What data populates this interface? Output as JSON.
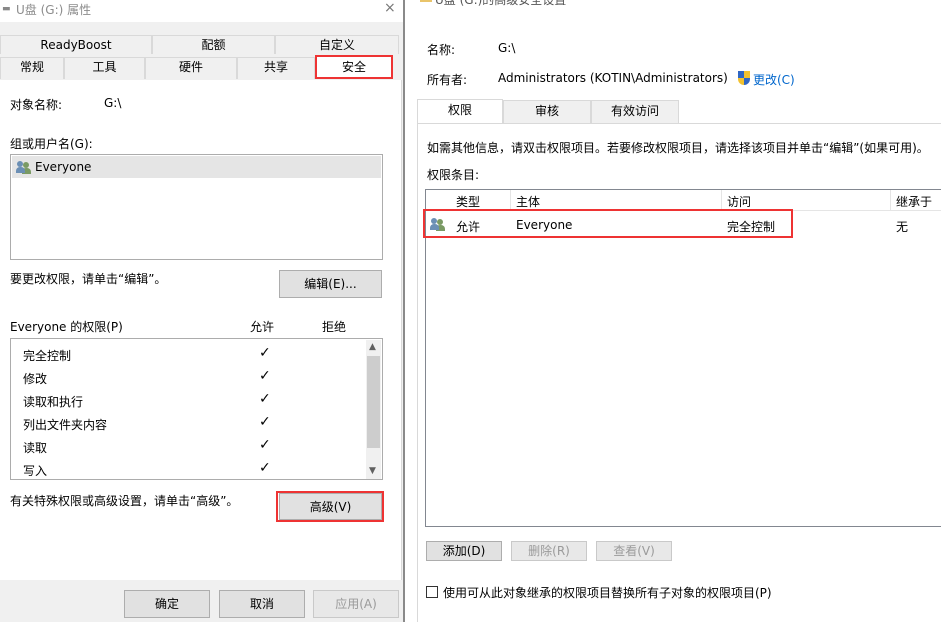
{
  "left": {
    "title": "U盘 (G:) 属性",
    "close_glyph": "×",
    "tabs_top": [
      "ReadyBoost",
      "配额",
      "自定义"
    ],
    "tabs_bottom": [
      "常规",
      "工具",
      "硬件",
      "共享",
      "安全"
    ],
    "object_name_label": "对象名称:",
    "object_name_value": "G:\\",
    "group_label": "组或用户名(G):",
    "groups": [
      {
        "name": "Everyone",
        "icon": "users-icon"
      }
    ],
    "edit_hint": "要更改权限，请单击“编辑”。",
    "edit_button": "编辑(E)...",
    "perm_header": "Everyone 的权限(P)",
    "allow_header": "允许",
    "deny_header": "拒绝",
    "permissions": [
      {
        "name": "完全控制",
        "allow": true
      },
      {
        "name": "修改",
        "allow": true
      },
      {
        "name": "读取和执行",
        "allow": true
      },
      {
        "name": "列出文件夹内容",
        "allow": true
      },
      {
        "name": "读取",
        "allow": true
      },
      {
        "name": "写入",
        "allow": true
      }
    ],
    "check_glyph": "✓",
    "advanced_hint": "有关特殊权限或高级设置，请单击“高级”。",
    "advanced_button": "高级(V)",
    "ok_button": "确定",
    "cancel_button": "取消",
    "apply_button": "应用(A)"
  },
  "right": {
    "title": "U盘 (G:)的高级安全设置",
    "name_label": "名称:",
    "name_value": "G:\\",
    "owner_label": "所有者:",
    "owner_value": "Administrators (KOTIN\\Administrators)",
    "change_link": "更改(C)",
    "tabs": [
      "权限",
      "审核",
      "有效访问"
    ],
    "info_text": "如需其他信息，请双击权限项目。若要修改权限项目，请选择该项目并单击“编辑”(如果可用)。",
    "entries_label": "权限条目:",
    "columns": [
      "类型",
      "主体",
      "访问",
      "继承于"
    ],
    "entries": [
      {
        "type": "允许",
        "principal": "Everyone",
        "access": "完全控制",
        "inherited": "无"
      }
    ],
    "add_button": "添加(D)",
    "remove_button": "删除(R)",
    "view_button": "查看(V)",
    "replace_checkbox": "使用可从此对象继承的权限项目替换所有子对象的权限项目(P)"
  },
  "colors": {
    "highlight": "#e33333",
    "link": "#0066cc"
  }
}
